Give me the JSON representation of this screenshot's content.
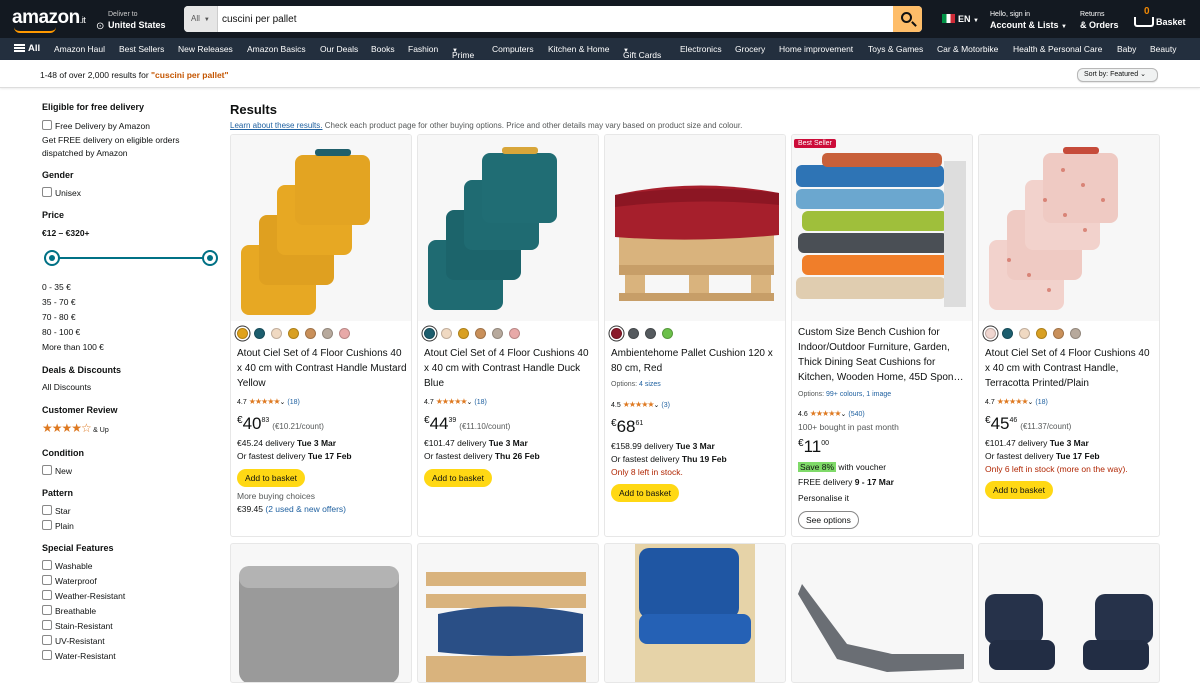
{
  "header": {
    "logo": "amazon",
    "logo_tld": ".it",
    "deliver_to": "Deliver to",
    "deliver_country": "United States",
    "search_category": "All",
    "search_query": "cuscini per pallet",
    "language": "EN",
    "account_line1": "Hello, sign in",
    "account_line2": "Account & Lists",
    "returns_line1": "Returns",
    "returns_line2": "& Orders",
    "cart_count": "0",
    "cart_label": "Basket"
  },
  "nav": [
    "All",
    "Amazon Haul",
    "Best Sellers",
    "New Releases",
    "Amazon Basics",
    "Our Deals",
    "Books",
    "Fashion",
    "Prime",
    "Computers",
    "Kitchen & Home",
    "Gift Cards",
    "Electronics",
    "Grocery",
    "Home improvement",
    "Toys & Games",
    "Car & Motorbike",
    "Health & Personal Care",
    "Baby",
    "Beauty"
  ],
  "results_bar": {
    "count_text": "1-48 of over 2,000 results for ",
    "query_text": "\"cuscini per pallet\"",
    "sort_label": "Sort by:",
    "sort_value": "Featured"
  },
  "sidebar": {
    "free_delivery_heading": "Eligible for free delivery",
    "free_delivery_option": "Free Delivery by Amazon",
    "free_delivery_note1": "Get FREE delivery on eligible orders",
    "free_delivery_note2": "dispatched by Amazon",
    "gender_heading": "Gender",
    "gender_option": "Unisex",
    "price_heading": "Price",
    "price_range": "€12 – €320+",
    "price_options": [
      "0 - 35 €",
      "35 - 70 €",
      "70 - 80 €",
      "80 - 100 €",
      "More than 100 €"
    ],
    "deals_heading": "Deals & Discounts",
    "deals_option": "All Discounts",
    "review_heading": "Customer Review",
    "review_option": "& Up",
    "condition_heading": "Condition",
    "condition_option": "New",
    "pattern_heading": "Pattern",
    "pattern_options": [
      "Star",
      "Plain"
    ],
    "features_heading": "Special Features",
    "features_options": [
      "Washable",
      "Waterproof",
      "Weather-Resistant",
      "Breathable",
      "Stain-Resistant",
      "UV-Resistant",
      "Water-Resistant"
    ]
  },
  "results": {
    "heading": "Results",
    "learn_link": "Learn about these results.",
    "note": " Check each product page for other buying options. Price and other details may vary based on product size and colour."
  },
  "products": [
    {
      "title": "Atout Ciel Set of 4 Floor Cushions 40 x 40 cm with Contrast Handle Mustard Yellow",
      "rating": "4.7",
      "reviews": "(18)",
      "price_whole": "40",
      "price_frac": "83",
      "unit_price": "(€10.21/count)",
      "delivery_prefix": "€45.24 delivery ",
      "delivery_date": "Tue 3 Mar",
      "fastest_prefix": "Or fastest delivery ",
      "fastest_date": "Tue 17 Feb",
      "button": "Add to basket",
      "more_label": "More buying choices",
      "more_price": "€39.45 ",
      "more_link": "(2 used & new offers)",
      "swatches": [
        "#e0a21a",
        "#1c5e6e",
        "#f0d9c2",
        "#d9a022",
        "#c9905a",
        "#b7a99c",
        "#e8a9a8"
      ]
    },
    {
      "title": "Atout Ciel Set of 4 Floor Cushions 40 x 40 cm with Contrast Handle Duck Blue",
      "rating": "4.7",
      "reviews": "(18)",
      "price_whole": "44",
      "price_frac": "39",
      "unit_price": "(€11.10/count)",
      "delivery_prefix": "€101.47 delivery ",
      "delivery_date": "Tue 3 Mar",
      "fastest_prefix": "Or fastest delivery ",
      "fastest_date": "Thu 26 Feb",
      "button": "Add to basket",
      "swatches": [
        "#1c5e6e",
        "#f0d9c2",
        "#d9a022",
        "#c9905a",
        "#b7a99c",
        "#e8a9a8"
      ]
    },
    {
      "title": "Ambientehome Pallet Cushion 120 x 80 cm, Red",
      "options_label": "Options: ",
      "options_link": "4 sizes",
      "rating": "4.5",
      "reviews": "(3)",
      "price_whole": "68",
      "price_frac": "61",
      "delivery_prefix": "€158.99 delivery ",
      "delivery_date": "Tue 3 Mar",
      "fastest_prefix": "Or fastest delivery ",
      "fastest_date": "Thu 19 Feb",
      "stock": "Only 8 left in stock.",
      "button": "Add to basket",
      "swatches": [
        "#8b1a2a",
        "#555a5e",
        "#555a5e",
        "#6cc04a"
      ]
    },
    {
      "badge": "Best Seller",
      "title": "Custom Size Bench Cushion for Indoor/Outdoor Furniture, Garden, Thick Dining Seat Cushions for Kitchen, Wooden Home, 45D Spon…",
      "options_label": "Options: ",
      "options_link": "99+ colours, 1 image",
      "rating": "4.6",
      "reviews": "(540)",
      "bought": "100+ bought in past month",
      "price_whole": "11",
      "price_frac": "00",
      "save": "Save 8%",
      "save_note": " with voucher",
      "free_delivery": "FREE delivery ",
      "free_delivery_date": "9 - 17 Mar",
      "personalise": "Personalise it",
      "button": "See options"
    },
    {
      "title": "Atout Ciel Set of 4 Floor Cushions 40 x 40 cm with Contrast Handle, Terracotta Printed/Plain",
      "rating": "4.7",
      "reviews": "(18)",
      "price_whole": "45",
      "price_frac": "46",
      "unit_price": "(€11.37/count)",
      "delivery_prefix": "€101.47 delivery ",
      "delivery_date": "Tue 3 Mar",
      "fastest_prefix": "Or fastest delivery ",
      "fastest_date": "Tue 17 Feb",
      "stock": "Only 6 left in stock (more on the way).",
      "button": "Add to basket",
      "swatches": [
        "#f0d6d0",
        "#1c5e6e",
        "#f0d9c2",
        "#d9a022",
        "#c9905a",
        "#b7a99c"
      ]
    }
  ],
  "colors": {
    "header_bg": "#131921",
    "nav_bg": "#232f3e",
    "accent": "#febd69",
    "link": "#2162a1",
    "price_red": "#b12704",
    "button_yellow": "#ffd814",
    "star": "#de7921"
  }
}
